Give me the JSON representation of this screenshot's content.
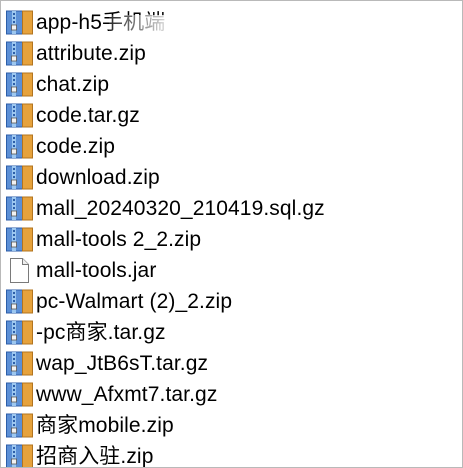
{
  "colors": {
    "zip_left": "#4a7fc9",
    "zip_right": "#d8922f",
    "zip_mid": "#86b8e8",
    "text": "#000000"
  },
  "files": [
    {
      "name": "app-h5手机端",
      "icon": "zip-archive-icon"
    },
    {
      "name": "attribute.zip",
      "icon": "zip-archive-icon"
    },
    {
      "name": "chat.zip",
      "icon": "zip-archive-icon"
    },
    {
      "name": "code.tar.gz",
      "icon": "zip-archive-icon"
    },
    {
      "name": "code.zip",
      "icon": "zip-archive-icon"
    },
    {
      "name": "download.zip",
      "icon": "zip-archive-icon"
    },
    {
      "name": "mall_20240320_210419.sql.gz",
      "icon": "zip-archive-icon"
    },
    {
      "name": "mall-tools 2_2.zip",
      "icon": "zip-archive-icon"
    },
    {
      "name": "mall-tools.jar",
      "icon": "blank-file-icon"
    },
    {
      "name": "pc-Walmart (2)_2.zip",
      "icon": "zip-archive-icon"
    },
    {
      "name": "-pc商家.tar.gz",
      "icon": "zip-archive-icon"
    },
    {
      "name": "wap_JtB6sT.tar.gz",
      "icon": "zip-archive-icon"
    },
    {
      "name": "www_Afxmt7.tar.gz",
      "icon": "zip-archive-icon"
    },
    {
      "name": "商家mobile.zip",
      "icon": "zip-archive-icon"
    },
    {
      "name": "招商入驻.zip",
      "icon": "zip-archive-icon"
    }
  ]
}
